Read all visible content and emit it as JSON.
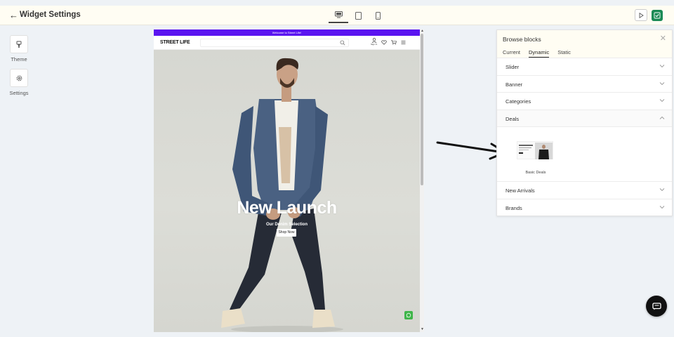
{
  "app": {
    "back_glyph": "←",
    "title": "Widget Settings"
  },
  "devices": [
    {
      "name": "desktop",
      "active": true
    },
    {
      "name": "tablet",
      "active": false
    },
    {
      "name": "mobile",
      "active": false
    }
  ],
  "sidebar": {
    "theme_label": "Theme",
    "settings_label": "Settings"
  },
  "preview": {
    "announcement": "Welcome to Street Life!",
    "logo": "STREET LIFE",
    "signin_label": "Sign In",
    "hero_title": "New Launch",
    "hero_subtitle": "Our Denim Selection",
    "hero_button": "Shop Now"
  },
  "panel": {
    "title": "Browse blocks",
    "close_glyph": "✕",
    "tabs": [
      {
        "label": "Current",
        "active": false
      },
      {
        "label": "Dynamic",
        "active": true
      },
      {
        "label": "Static",
        "active": false
      }
    ],
    "sections_before": [
      {
        "label": "Slider"
      },
      {
        "label": "Banner"
      },
      {
        "label": "Categories"
      },
      {
        "label": "Deals"
      }
    ],
    "deals_block_label": "Basic Deals",
    "sections_after": [
      {
        "label": "New Arrivals"
      },
      {
        "label": "Brands"
      }
    ]
  },
  "colors": {
    "announcement_bar": "#5a14f0",
    "save_button": "#1a8a55",
    "whatsapp": "#3fb54a",
    "topbar": "#fffdf3"
  }
}
